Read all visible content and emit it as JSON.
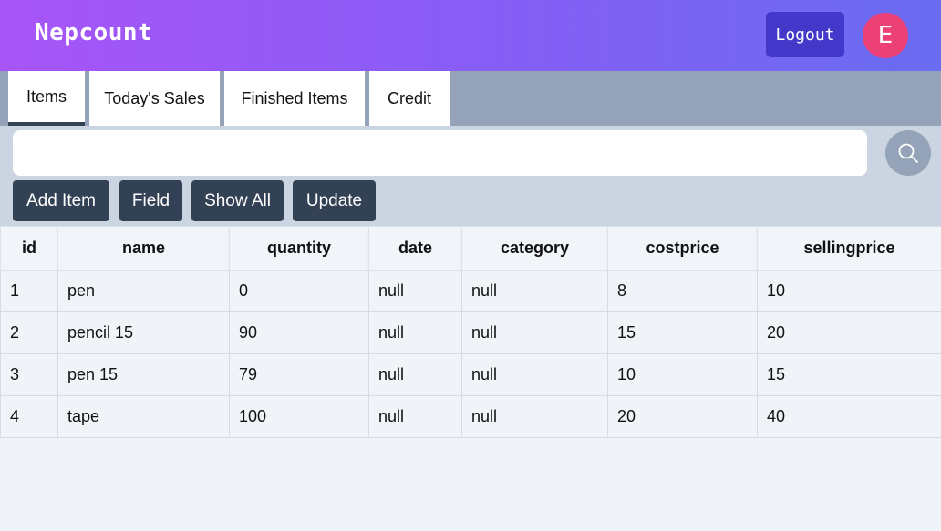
{
  "header": {
    "brand": "Nepcount",
    "logout_label": "Logout",
    "avatar_initial": "E"
  },
  "tabs": [
    {
      "label": "Items",
      "active": true
    },
    {
      "label": "Today's Sales",
      "active": false
    },
    {
      "label": "Finished Items",
      "active": false
    },
    {
      "label": "Credit",
      "active": false
    }
  ],
  "search": {
    "value": "",
    "icon": "search-icon"
  },
  "actions": {
    "add_item": "Add Item",
    "field": "Field",
    "show_all": "Show All",
    "update": "Update"
  },
  "table": {
    "columns": [
      "id",
      "name",
      "quantity",
      "date",
      "category",
      "costprice",
      "sellingprice"
    ],
    "rows": [
      [
        "1",
        "pen",
        "0",
        "null",
        "null",
        "8",
        "10"
      ],
      [
        "2",
        "pencil 15",
        "90",
        "null",
        "null",
        "15",
        "20"
      ],
      [
        "3",
        "pen 15",
        "79",
        "null",
        "null",
        "10",
        "15"
      ],
      [
        "4",
        "tape",
        "100",
        "null",
        "null",
        "20",
        "40"
      ]
    ]
  },
  "colors": {
    "header_gradient_start": "#a855f7",
    "header_gradient_end": "#6a6cf2",
    "logout_bg": "#4338ca",
    "avatar_bg": "#ec4176",
    "button_bg": "#334155"
  }
}
